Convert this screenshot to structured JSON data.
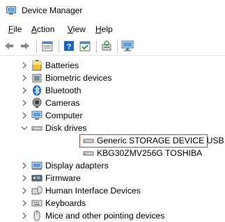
{
  "window": {
    "title": "Device Manager"
  },
  "menu": [
    {
      "label": "File",
      "mnemonic": "F",
      "rest": "ile"
    },
    {
      "label": "Action",
      "mnemonic": "A",
      "rest": "ction"
    },
    {
      "label": "View",
      "mnemonic": "V",
      "rest": "iew"
    },
    {
      "label": "Help",
      "mnemonic": "H",
      "rest": "elp"
    }
  ],
  "toolbar": {
    "buttons": [
      "back-icon",
      "forward-icon",
      "properties-icon",
      "help-icon",
      "show-hidden-icon",
      "scan-hardware-icon",
      "monitor-icon"
    ]
  },
  "tree": {
    "items": [
      {
        "label": "Batteries",
        "icon": "battery-icon"
      },
      {
        "label": "Biometric devices",
        "icon": "biometric-icon"
      },
      {
        "label": "Bluetooth",
        "icon": "bluetooth-icon"
      },
      {
        "label": "Cameras",
        "icon": "camera-icon"
      },
      {
        "label": "Computer",
        "icon": "computer-icon"
      },
      {
        "label": "Disk drives",
        "icon": "disk-drive-icon",
        "expanded": true,
        "children": [
          {
            "label": "Generic STORAGE DEVICE USB Device",
            "icon": "disk-drive-icon",
            "highlighted": true
          },
          {
            "label": "KBG30ZMV256G TOSHIBA",
            "icon": "disk-drive-icon"
          }
        ]
      },
      {
        "label": "Display adapters",
        "icon": "display-adapter-icon"
      },
      {
        "label": "Firmware",
        "icon": "firmware-icon"
      },
      {
        "label": "Human Interface Devices",
        "icon": "hid-icon"
      },
      {
        "label": "Keyboards",
        "icon": "keyboard-icon"
      },
      {
        "label": "Mice and other pointing devices",
        "icon": "mouse-icon"
      }
    ]
  },
  "colors": {
    "highlight_border": "#d83b3b",
    "bluetooth": "#1e6fd9",
    "toolbar_blue": "#1b64c4"
  }
}
